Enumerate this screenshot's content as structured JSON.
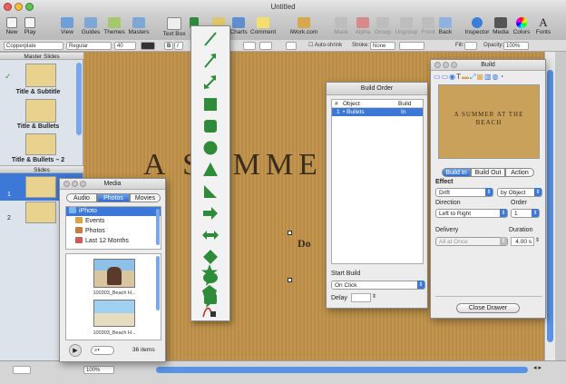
{
  "window": {
    "title": "Untitled"
  },
  "toolbar": {
    "items": [
      "New",
      "Play",
      "View",
      "Guides",
      "Themes",
      "Masters",
      "Text Box",
      "Shapes",
      "Table",
      "Charts",
      "Comment",
      "iWork.com",
      "Mask",
      "Alpha",
      "Group",
      "Ungroup",
      "Front",
      "Back",
      "Inspector",
      "Media",
      "Colors",
      "Fonts"
    ],
    "shapes_label": "S"
  },
  "formatbar": {
    "font_family": "Copperplate",
    "font_style": "Regular",
    "font_size": "40",
    "bold": "B",
    "italic": "I",
    "autoshrink": "Auto-shrink",
    "stroke_label": "Stroke:",
    "stroke_value": "None",
    "fill_label": "Fill:",
    "opacity_label": "Opacity:",
    "opacity_value": "100%"
  },
  "navigator": {
    "master_header": "Master Slides",
    "masters": [
      "Title & Subtitle",
      "Title & Bullets",
      "Title & Bullets – 2"
    ],
    "slides_header": "Slides",
    "slide_numbers": [
      "1",
      "2"
    ]
  },
  "slide": {
    "title": "A SUMME",
    "subtitle": "Do"
  },
  "media": {
    "title": "Media",
    "tabs": [
      "Audio",
      "Photos",
      "Movies"
    ],
    "sources": [
      "iPhoto",
      "Events",
      "Photos",
      "Last 12 Months"
    ],
    "photos": [
      "100303_Beach H...",
      "100303_Beach H..."
    ],
    "count": "36 items"
  },
  "build_order": {
    "title": "Build Order",
    "columns": [
      "#",
      "Object",
      "Build"
    ],
    "rows": [
      {
        "num": "1",
        "object": "Bullets",
        "build": "In"
      }
    ],
    "start_build_label": "Start Build",
    "start_build_value": "On Click",
    "delay_label": "Delay"
  },
  "build": {
    "title": "Build",
    "preview_text": "A SUMMER AT THE BEACH",
    "tabs": [
      "Build In",
      "Build Out",
      "Action"
    ],
    "effect_label": "Effect",
    "effect_value": "Drift",
    "by_value": "by Object",
    "direction_label": "Direction",
    "direction_value": "Left to Right",
    "order_label": "Order",
    "order_value": "1",
    "delivery_label": "Delivery",
    "delivery_value": "All at Once",
    "duration_label": "Duration",
    "duration_value": "4.00 s",
    "close_label": "Close Drawer"
  },
  "status": {
    "zoom": "100%"
  },
  "colors": {
    "canvas": "#bf9249",
    "selection": "#3b78d8",
    "title_text": "#3a2d1d"
  }
}
